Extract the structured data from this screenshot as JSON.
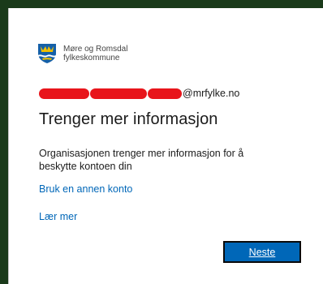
{
  "org": {
    "logo_icon": "county-shield-icon",
    "name_line1": "Møre og Romsdal",
    "name_line2": "fylkeskommune"
  },
  "account": {
    "domain": "@mrfylke.no"
  },
  "title": "Trenger mer informasjon",
  "description": "Organisasjonen trenger mer informasjon for å beskytte kontoen din",
  "links": {
    "other_account": "Bruk en annen konto",
    "learn_more": "Lær mer"
  },
  "button": {
    "next_label": "Neste"
  },
  "colors": {
    "link": "#0067b8",
    "button": "#0067b8",
    "redaction": "#e8151b",
    "frame": "#1a3a1a"
  }
}
